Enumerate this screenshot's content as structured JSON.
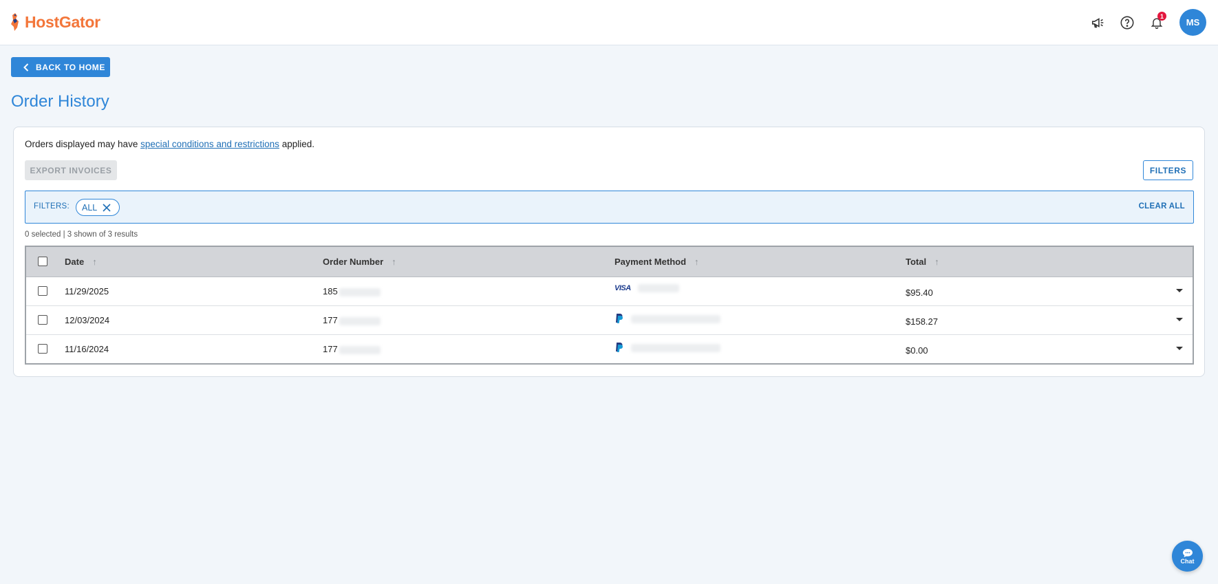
{
  "header": {
    "brand": "HostGator",
    "notification_count": "1",
    "avatar_initials": "MS",
    "icons": [
      "megaphone-icon",
      "help-icon",
      "bell-icon"
    ]
  },
  "nav": {
    "back_label": "BACK TO HOME"
  },
  "page": {
    "title": "Order History"
  },
  "notice": {
    "prefix": "Orders displayed may have ",
    "link": "special conditions and restrictions",
    "suffix": " applied."
  },
  "toolbar": {
    "export_label": "EXPORT INVOICES",
    "filters_label": "FILTERS"
  },
  "filter_bar": {
    "label": "FILTERS:",
    "chip": "ALL",
    "clear_label": "CLEAR ALL"
  },
  "selection": {
    "summary": "0 selected | 3 shown of 3 results"
  },
  "table": {
    "columns": [
      "Date",
      "Order Number",
      "Payment Method",
      "Total"
    ],
    "rows": [
      {
        "date": "11/29/2025",
        "order_prefix": "185",
        "payment": "visa",
        "total": "$95.40"
      },
      {
        "date": "12/03/2024",
        "order_prefix": "177",
        "payment": "paypal",
        "total": "$158.27"
      },
      {
        "date": "11/16/2024",
        "order_prefix": "177",
        "payment": "paypal",
        "total": "$0.00"
      }
    ],
    "visa_label": "VISA"
  },
  "chat": {
    "label": "Chat"
  },
  "colors": {
    "brand_orange": "#f3763a",
    "primary_blue": "#2f86d8",
    "badge_red": "#e3173e"
  }
}
